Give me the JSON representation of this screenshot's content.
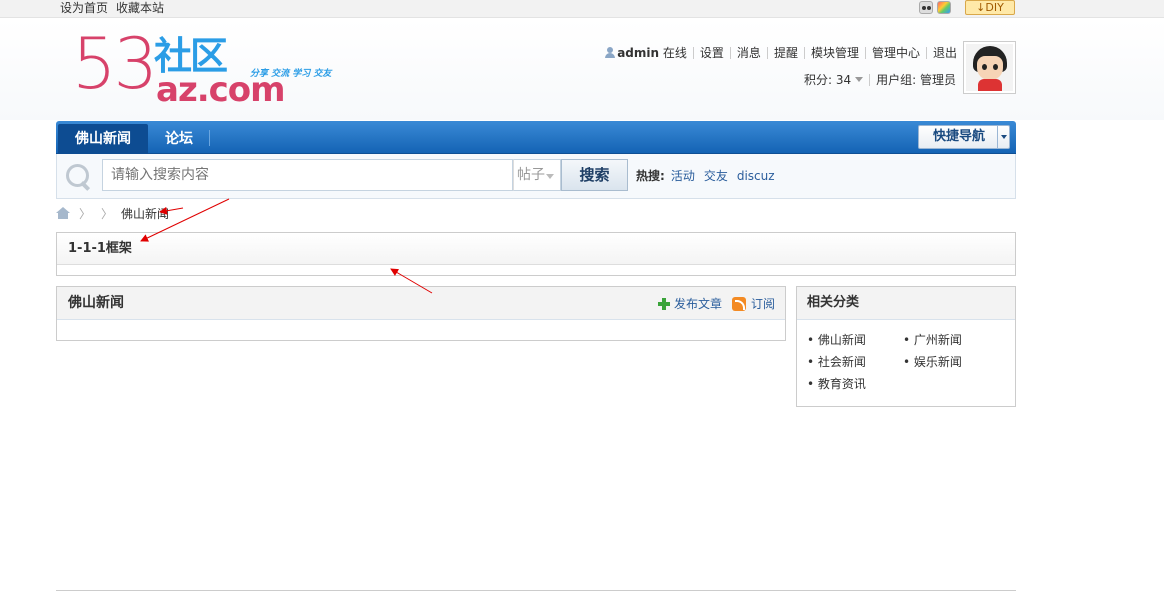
{
  "topbar": {
    "set_home": "设为首页",
    "bookmark": "收藏本站",
    "diy": "DIY"
  },
  "logo": {
    "digits": "53",
    "name": "社区",
    "domain": "az.com",
    "slogan": "分享 交流 学习 交友"
  },
  "user": {
    "username": "admin",
    "status": "在线",
    "links": [
      "设置",
      "消息",
      "提醒",
      "模块管理",
      "管理中心",
      "退出"
    ],
    "points_label": "积分: 34",
    "group_label": "用户组: 管理员"
  },
  "nav": {
    "tabs": [
      "佛山新闻",
      "论坛"
    ],
    "quick_nav": "快捷导航"
  },
  "search": {
    "placeholder": "请输入搜索内容",
    "type": "帖子",
    "button": "搜索",
    "hot_label": "热搜:",
    "hot_terms": [
      "活动",
      "交友",
      "discuz"
    ]
  },
  "breadcrumb": {
    "current": "佛山新闻"
  },
  "frame": {
    "title": "1-1-1框架"
  },
  "main_panel": {
    "title": "佛山新闻",
    "publish": "发布文章",
    "subscribe": "订阅"
  },
  "side_panel": {
    "title": "相关分类",
    "items": [
      "佛山新闻",
      "广州新闻",
      "社会新闻",
      "娱乐新闻",
      "教育资讯"
    ]
  },
  "colors": {
    "nav_blue": "#1463b4",
    "logo_pink": "#d7426a",
    "logo_blue": "#2b9de6",
    "annotation_red": "#e00000"
  }
}
